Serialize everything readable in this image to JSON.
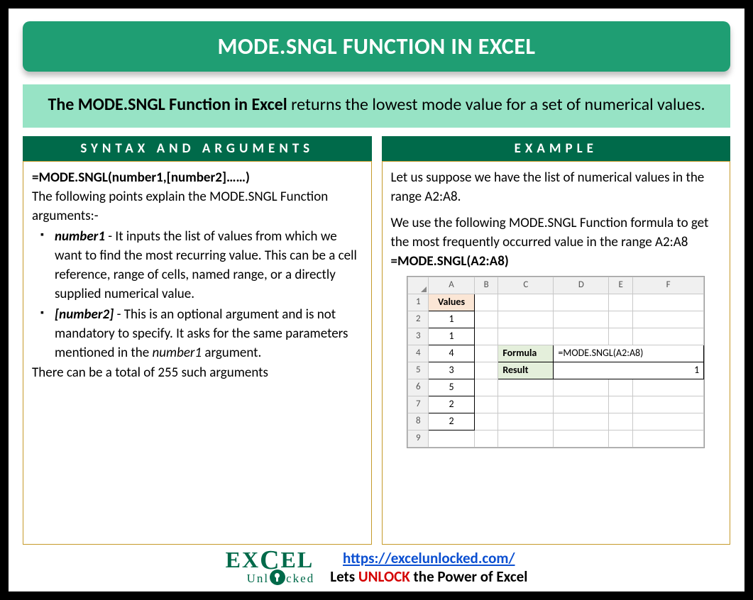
{
  "title": "MODE.SNGL FUNCTION IN EXCEL",
  "description": {
    "bold": "The MODE.SNGL Function in Excel",
    "rest": " returns the lowest mode value for a set of numerical values."
  },
  "syntax": {
    "header": "SYNTAX AND ARGUMENTS",
    "formula": "=MODE.SNGL(number1,[number2]……)",
    "intro": "The following points explain the MODE.SNGL Function arguments:-",
    "args": [
      {
        "name": "number1",
        "text": " - It inputs the list of values from which we want to find the most recurring value. This can be a cell reference, range of cells, named range, or a directly supplied numerical value."
      },
      {
        "name": "[number2]",
        "text_pre": " - This is an optional argument and is not mandatory to specify. It asks for the same parameters mentioned in the ",
        "ref": "number1",
        "text_post": " argument."
      }
    ],
    "outro": "There can be a total of 255 such arguments"
  },
  "example": {
    "header": "EXAMPLE",
    "p1": "Let us suppose we have the list of numerical values in the range A2:A8.",
    "p2": "We use the following MODE.SNGL Function formula to get the most frequently occurred value in the range A2:A8",
    "formula": "=MODE.SNGL(A2:A8)",
    "sheet": {
      "cols": [
        "A",
        "B",
        "C",
        "D",
        "E",
        "F"
      ],
      "values_header": "Values",
      "values": [
        "1",
        "1",
        "4",
        "3",
        "5",
        "2",
        "2"
      ],
      "formula_label": "Formula",
      "formula_value": "=MODE.SNGL(A2:A8)",
      "result_label": "Result",
      "result_value": "1"
    }
  },
  "footer": {
    "logo_l1_a": "EX",
    "logo_l1_b": "EL",
    "logo_l2_a": "Unl",
    "logo_l2_b": "cked",
    "url": "https://excelunlocked.com/",
    "tag_pre": "Lets ",
    "tag_unlock": "UNLOCK",
    "tag_post": " the Power of Excel"
  }
}
